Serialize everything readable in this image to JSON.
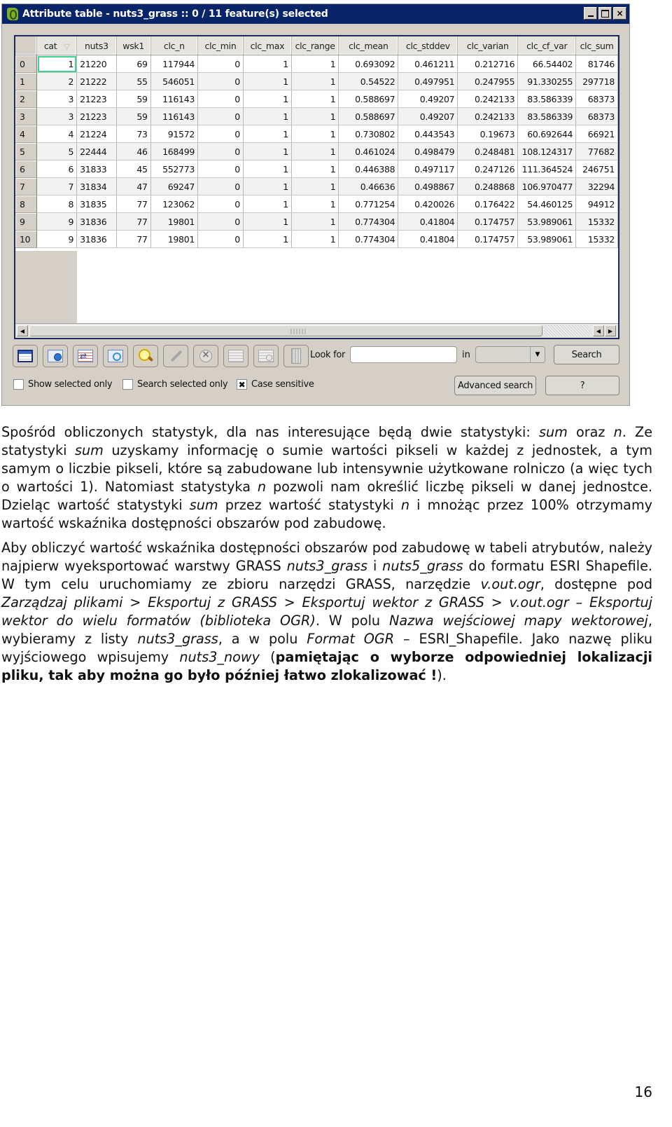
{
  "window": {
    "title": "Attribute table - nuts3_grass :: 0 / 11 feature(s) selected",
    "controls": {
      "minimize": "_",
      "maximize": "□",
      "close": "×"
    }
  },
  "table": {
    "columns": [
      "cat",
      "nuts3",
      "wsk1",
      "clc_n",
      "clc_min",
      "clc_max",
      "clc_range",
      "clc_mean",
      "clc_stddev",
      "clc_varian",
      "clc_cf_var",
      "clc_sum"
    ],
    "sorted_column": "cat",
    "rows": [
      {
        "id": "0",
        "cells": [
          "1",
          "21220",
          "69",
          "117944",
          "0",
          "1",
          "1",
          "0.693092",
          "0.461211",
          "0.212716",
          "66.54402",
          "81746"
        ]
      },
      {
        "id": "1",
        "cells": [
          "2",
          "21222",
          "55",
          "546051",
          "0",
          "1",
          "1",
          "0.54522",
          "0.497951",
          "0.247955",
          "91.330255",
          "297718"
        ]
      },
      {
        "id": "2",
        "cells": [
          "3",
          "21223",
          "59",
          "116143",
          "0",
          "1",
          "1",
          "0.588697",
          "0.49207",
          "0.242133",
          "83.586339",
          "68373"
        ]
      },
      {
        "id": "3",
        "cells": [
          "3",
          "21223",
          "59",
          "116143",
          "0",
          "1",
          "1",
          "0.588697",
          "0.49207",
          "0.242133",
          "83.586339",
          "68373"
        ]
      },
      {
        "id": "4",
        "cells": [
          "4",
          "21224",
          "73",
          "91572",
          "0",
          "1",
          "1",
          "0.730802",
          "0.443543",
          "0.19673",
          "60.692644",
          "66921"
        ]
      },
      {
        "id": "5",
        "cells": [
          "5",
          "22444",
          "46",
          "168499",
          "0",
          "1",
          "1",
          "0.461024",
          "0.498479",
          "0.248481",
          "108.124317",
          "77682"
        ]
      },
      {
        "id": "6",
        "cells": [
          "6",
          "31833",
          "45",
          "552773",
          "0",
          "1",
          "1",
          "0.446388",
          "0.497117",
          "0.247126",
          "111.364524",
          "246751"
        ]
      },
      {
        "id": "7",
        "cells": [
          "7",
          "31834",
          "47",
          "69247",
          "0",
          "1",
          "1",
          "0.46636",
          "0.498867",
          "0.248868",
          "106.970477",
          "32294"
        ]
      },
      {
        "id": "8",
        "cells": [
          "8",
          "31835",
          "77",
          "123062",
          "0",
          "1",
          "1",
          "0.771254",
          "0.420026",
          "0.176422",
          "54.460125",
          "94912"
        ]
      },
      {
        "id": "9",
        "cells": [
          "9",
          "31836",
          "77",
          "19801",
          "0",
          "1",
          "1",
          "0.774304",
          "0.41804",
          "0.174757",
          "53.989061",
          "15332"
        ]
      },
      {
        "id": "10",
        "cells": [
          "9",
          "31836",
          "77",
          "19801",
          "0",
          "1",
          "1",
          "0.774304",
          "0.41804",
          "0.174757",
          "53.989061",
          "15332"
        ]
      }
    ]
  },
  "toolbar": {
    "icons": [
      "table-icon",
      "zoom-to-selection-icon",
      "invert-selection-icon",
      "pan-to-selection-icon",
      "zoom-icon",
      "edit-pencil-icon",
      "delete-icon",
      "new-column-icon",
      "delete-column-icon",
      "field-calculator-icon"
    ],
    "look_for_label": "Look for",
    "look_for_value": "",
    "in_label": "in",
    "in_value": "",
    "search_label": "Search",
    "advanced_search_label": "Advanced search",
    "help_label": "?"
  },
  "options": {
    "show_selected_only": {
      "label": "Show selected only",
      "checked": false
    },
    "search_selected_only": {
      "label": "Search selected only",
      "checked": false
    },
    "case_sensitive": {
      "label": "Case sensitive",
      "checked": true,
      "mark": "✖"
    }
  },
  "document": {
    "p1": [
      {
        "t": "Spośród obliczonych statystyk, dla nas interesujące będą dwie statystyki: "
      },
      {
        "t": "sum",
        "s": "i"
      },
      {
        "t": " oraz "
      },
      {
        "t": "n",
        "s": "i"
      },
      {
        "t": ". Ze statystyki "
      },
      {
        "t": "sum",
        "s": "i"
      },
      {
        "t": " uzyskamy informację o sumie wartości pikseli w każdej z jednostek, a tym samym o liczbie pikseli, które są zabudowane lub intensywnie użytkowane rolniczo (a więc tych o wartości 1). Natomiast statystyka "
      },
      {
        "t": "n",
        "s": "i"
      },
      {
        "t": " pozwoli nam określić liczbę pikseli w danej jednostce. Dzieląc wartość statystyki "
      },
      {
        "t": "sum",
        "s": "i"
      },
      {
        "t": " przez wartość statystyki "
      },
      {
        "t": "n",
        "s": "i"
      },
      {
        "t": " i mnożąc przez 100% otrzymamy wartość wskaźnika dostępności obszarów pod zabudowę."
      }
    ],
    "p2": [
      {
        "t": "Aby obliczyć wartość wskaźnika dostępności obszarów pod zabudowę w tabeli atrybutów, należy najpierw wyeksportować warstwy GRASS "
      },
      {
        "t": "nuts3_grass",
        "s": "i"
      },
      {
        "t": " i "
      },
      {
        "t": "nuts5_grass",
        "s": "i"
      },
      {
        "t": " do formatu ESRI Shapefile. W tym celu uruchomiamy ze zbioru narzędzi GRASS, narzędzie "
      },
      {
        "t": "v.out.ogr",
        "s": "i"
      },
      {
        "t": ", dostępne pod "
      },
      {
        "t": "Zarządzaj plikami > Eksportuj z GRASS > Eksportuj wektor z GRASS > v.out.ogr",
        "s": "i"
      },
      {
        "t": " – "
      },
      {
        "t": "Eksportuj wektor do wielu formatów (biblioteka OGR)",
        "s": "i"
      },
      {
        "t": ". W polu "
      },
      {
        "t": "Nazwa wejściowej mapy wektorowej",
        "s": "i"
      },
      {
        "t": ", wybieramy z listy "
      },
      {
        "t": "nuts3_grass",
        "s": "i"
      },
      {
        "t": ", a w polu "
      },
      {
        "t": "Format OGR",
        "s": "i"
      },
      {
        "t": " – ESRI_Shapefile. Jako nazwę pliku wyjściowego wpisujemy "
      },
      {
        "t": "nuts3_nowy",
        "s": "i"
      },
      {
        "t": " ("
      },
      {
        "t": "pamiętając o wyborze odpowiedniej lokalizacji pliku, tak aby można go było później łatwo zlokalizować !",
        "s": "b"
      },
      {
        "t": ")."
      }
    ],
    "page_number": "16"
  }
}
